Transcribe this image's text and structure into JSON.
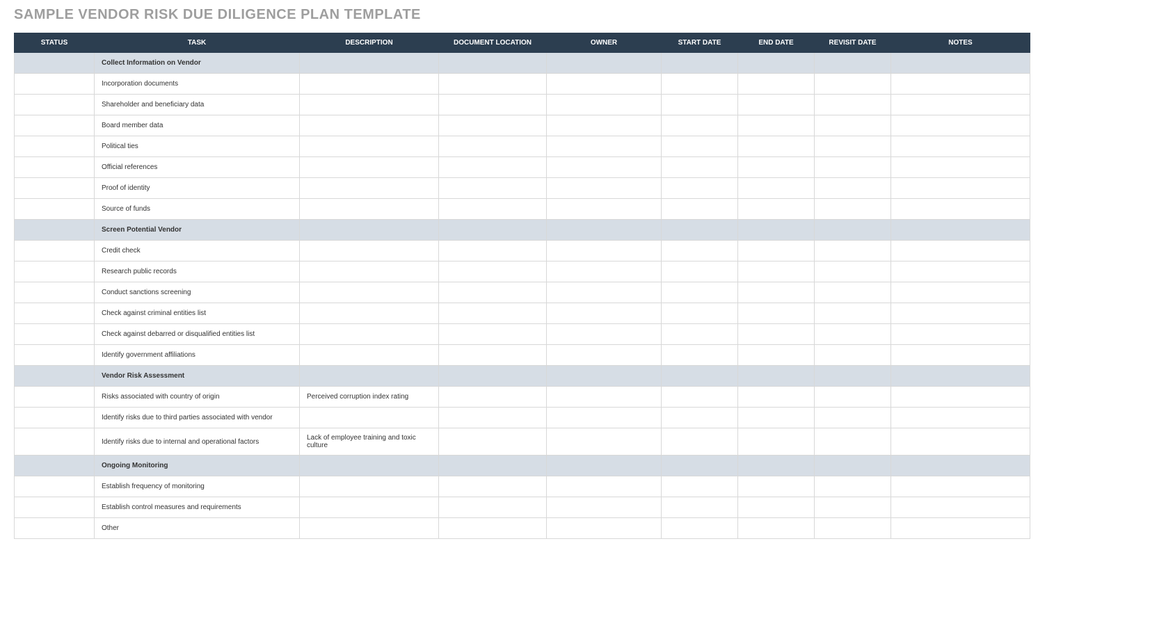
{
  "title": "SAMPLE VENDOR RISK DUE DILIGENCE PLAN TEMPLATE",
  "columns": {
    "status": "STATUS",
    "task": "TASK",
    "description": "DESCRIPTION",
    "doc_location": "DOCUMENT LOCATION",
    "owner": "OWNER",
    "start_date": "START DATE",
    "end_date": "END DATE",
    "revisit_date": "REVISIT DATE",
    "notes": "NOTES"
  },
  "rows": [
    {
      "type": "section",
      "task": "Collect Information on Vendor"
    },
    {
      "type": "data",
      "task": "Incorporation documents"
    },
    {
      "type": "data",
      "task": "Shareholder and beneficiary data"
    },
    {
      "type": "data",
      "task": "Board member data"
    },
    {
      "type": "data",
      "task": "Political ties"
    },
    {
      "type": "data",
      "task": "Official references"
    },
    {
      "type": "data",
      "task": "Proof of identity"
    },
    {
      "type": "data",
      "task": "Source of funds"
    },
    {
      "type": "section",
      "task": "Screen Potential Vendor"
    },
    {
      "type": "data",
      "task": "Credit check"
    },
    {
      "type": "data",
      "task": "Research public records"
    },
    {
      "type": "data",
      "task": "Conduct sanctions screening"
    },
    {
      "type": "data",
      "task": "Check against criminal entities list"
    },
    {
      "type": "data",
      "task": "Check against debarred or disqualified entities list"
    },
    {
      "type": "data",
      "task": "Identify government affiliations"
    },
    {
      "type": "section",
      "task": "Vendor Risk Assessment"
    },
    {
      "type": "data",
      "task": "Risks associated with country of origin",
      "description": "Perceived corruption index rating"
    },
    {
      "type": "data",
      "task": "Identify risks due to third parties associated with vendor"
    },
    {
      "type": "data",
      "task": "Identify risks due to internal and operational factors",
      "description": "Lack of employee training and toxic culture"
    },
    {
      "type": "section",
      "task": "Ongoing Monitoring"
    },
    {
      "type": "data",
      "task": "Establish frequency of monitoring"
    },
    {
      "type": "data",
      "task": "Establish control measures and requirements"
    },
    {
      "type": "data",
      "task": "Other"
    }
  ]
}
